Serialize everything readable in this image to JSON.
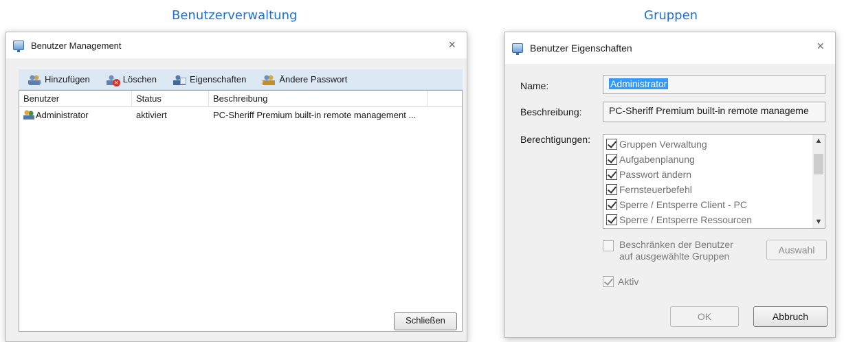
{
  "captions": {
    "left": "Benutzerverwaltung",
    "right": "Gruppen"
  },
  "left_window": {
    "title": "Benutzer Management",
    "close_glyph": "×",
    "toolbar": {
      "add": "Hinzufügen",
      "delete": "Löschen",
      "properties": "Eigenschaften",
      "change_password": "Ändere Passwort"
    },
    "table": {
      "columns": [
        "Benutzer",
        "Status",
        "Beschreibung",
        ""
      ],
      "rows": [
        {
          "user": "Administrator",
          "status": "aktiviert",
          "description": "PC-Sheriff Premium built-in remote management ..."
        }
      ]
    },
    "close_button": "Schließen"
  },
  "right_window": {
    "title": "Benutzer Eigenschaften",
    "close_glyph": "×",
    "name_label": "Name:",
    "name_value": "Administrator",
    "desc_label": "Beschreibung:",
    "desc_value": "PC-Sheriff Premium built-in remote manageme",
    "perm_label": "Berechtigungen:",
    "permissions": [
      {
        "label": "Gruppen Verwaltung",
        "checked": true
      },
      {
        "label": "Aufgabenplanung",
        "checked": true
      },
      {
        "label": "Passwort ändern",
        "checked": true
      },
      {
        "label": "Fernsteuerbefehl",
        "checked": true
      },
      {
        "label": "Sperre / Entsperre Client - PC",
        "checked": true
      },
      {
        "label": "Sperre / Entsperre Ressourcen",
        "checked": true
      }
    ],
    "restrict_line1": "Beschränken der Benutzer",
    "restrict_line2": "auf ausgewählte Gruppen",
    "select_button": "Auswahl",
    "active_label": "Aktiv",
    "ok_button": "OK",
    "cancel_button": "Abbruch"
  },
  "colors": {
    "caption": "#1f6fd1",
    "toolbar_bg": "#dde8f5",
    "selection": "#3399ff"
  }
}
